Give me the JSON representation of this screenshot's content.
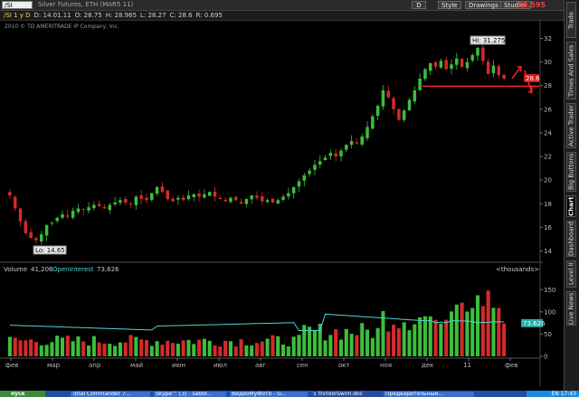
{
  "toolbar": {
    "symbol_input": "/SI",
    "description": "Silver Futures, ETH (MAR5 11)",
    "buttons": [
      "D",
      "Style",
      "Drawings",
      "Studies"
    ],
    "last_price": "28.595"
  },
  "ohlc": {
    "symbol": "/SI 1 y D",
    "d": "D: 14.01.11",
    "o": "O: 28.75",
    "h": "H: 28.965",
    "l": "L: 28.27",
    "c": "C: 28.6",
    "r": "R: 0.695"
  },
  "copyright": "2010 © TD AMERITRADE IP Company, Inc.",
  "price_chart": {
    "y_ticks": [
      "32",
      "30",
      "28",
      "26",
      "24",
      "22",
      "20",
      "18",
      "16",
      "14"
    ],
    "hi_label": "Hi: 31.275",
    "lo_label": "Lo: 14.65",
    "price_tag": "28.6"
  },
  "volume_panel": {
    "volume_label": "Volume",
    "volume_value": "41,206",
    "oi_label": "OpenInterest",
    "oi_value": "73,626",
    "units": "<thousands>",
    "y_ticks": [
      "150",
      "100",
      "50",
      "0"
    ],
    "oi_tag": "73.626"
  },
  "x_axis": [
    "фев",
    "мар",
    "апр",
    "май",
    "июн",
    "июл",
    "авг",
    "сен",
    "окт",
    "ноя",
    "дек",
    "11",
    "фев"
  ],
  "sidebar_tabs": [
    "Trade",
    "Times And Sales",
    "Active Trader",
    "Big Buttons",
    "Chart",
    "Dashboard",
    "Level II",
    "Live News"
  ],
  "taskbar": {
    "start": "пуск",
    "tasks": [
      "Total Commander 7...",
      "Skype™ [3] - sabor...",
      "ВидеоМуФото - G...",
      "5 thinkorswim.doc",
      "Предварительный..."
    ],
    "clock": "EN  17:43"
  },
  "colors": {
    "up": "#3bbf3b",
    "down": "#d42a2a",
    "oi_line": "#4fd3d3",
    "support_line": "#ff2020",
    "price_tag": "#e01a1a"
  },
  "chart_data": {
    "type": "candlestick",
    "title": "Silver Futures, ETH (MAR5 11)",
    "ylim": [
      13.5,
      32.5
    ],
    "x_labels": [
      "фев",
      "мар",
      "апр",
      "май",
      "июн",
      "июл",
      "авг",
      "сен",
      "окт",
      "ноя",
      "дек",
      "11",
      "фев"
    ],
    "close_series": [
      18.7,
      17.6,
      16.5,
      15.5,
      15.1,
      14.9,
      15.4,
      16.2,
      16.4,
      16.8,
      17.1,
      16.9,
      17.4,
      17.6,
      17.5,
      17.7,
      17.9,
      17.8,
      17.6,
      17.9,
      18.1,
      18.3,
      18.1,
      18.0,
      18.6,
      18.4,
      18.3,
      18.9,
      19.4,
      19.0,
      18.4,
      18.2,
      18.5,
      18.3,
      18.7,
      18.8,
      18.6,
      18.8,
      19.0,
      18.6,
      18.4,
      18.2,
      18.5,
      18.3,
      18.0,
      18.4,
      18.7,
      18.5,
      18.2,
      18.3,
      18.1,
      18.3,
      18.6,
      18.9,
      19.4,
      19.9,
      20.4,
      20.8,
      21.3,
      21.6,
      21.9,
      22.3,
      22.0,
      22.5,
      23.0,
      23.3,
      23.1,
      23.7,
      24.5,
      25.4,
      26.3,
      27.6,
      27.0,
      26.0,
      25.1,
      25.9,
      26.8,
      27.6,
      28.6,
      29.4,
      29.9,
      29.6,
      30.1,
      29.4,
      29.8,
      30.3,
      29.6,
      30.0,
      30.6,
      31.2,
      30.1,
      29.0,
      29.7,
      28.9,
      28.6
    ],
    "hi": 31.275,
    "lo": 14.65,
    "last": 28.6,
    "volume_ylim": [
      0,
      175
    ],
    "open_interest_last": 73.626
  }
}
